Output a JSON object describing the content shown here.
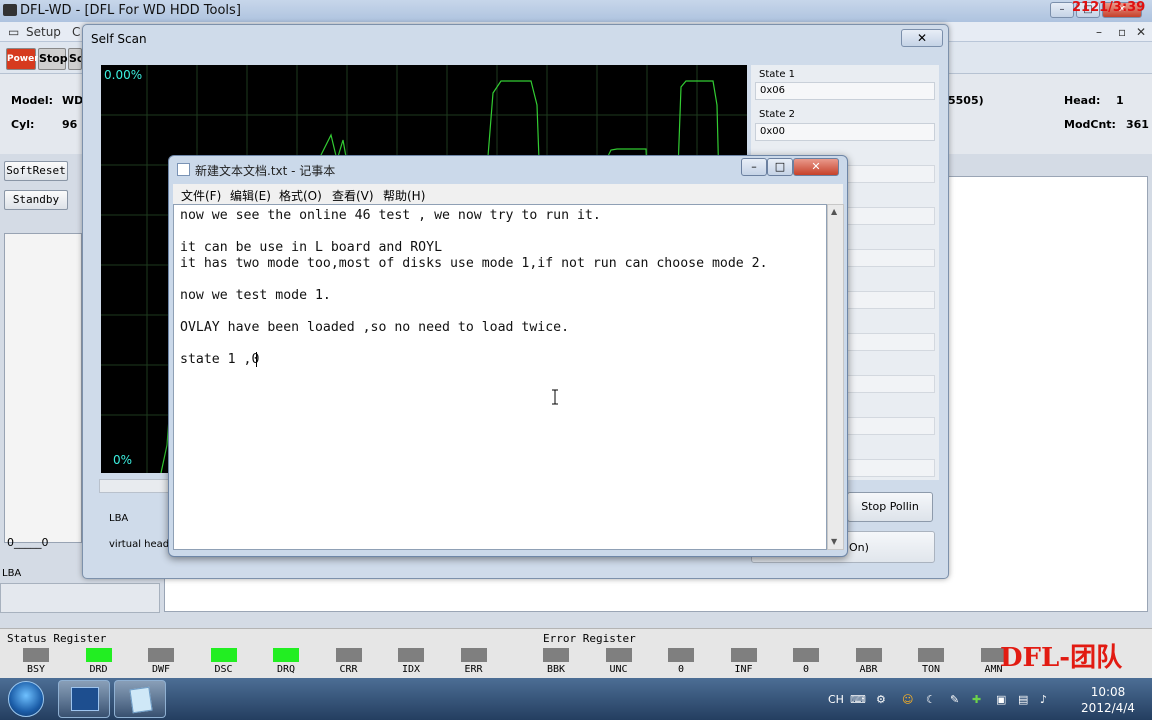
{
  "main": {
    "title": "DFL-WD - [DFL For WD HDD Tools]",
    "overlay_time": "2121/3:39",
    "menu": [
      "Setup",
      "C"
    ],
    "toolbar": {
      "power": "Power",
      "stop": "Stop",
      "third": "Sc"
    },
    "info": {
      "model_label": "Model:",
      "model_value": "WD",
      "cyl_label": "Cyl:",
      "cyl_value": "96",
      "right_fragment": "5505)",
      "head_label": "Head:",
      "head_value": "1",
      "modcnt_label": "ModCnt:",
      "modcnt_value": "361"
    },
    "buttons": {
      "softreset": "SoftReset",
      "standby": "Standby"
    },
    "left_counter": "0_____0",
    "lba_label": "LBA"
  },
  "self_scan": {
    "title": "Self Scan",
    "close": "✕",
    "chart_top_label": "0.00%",
    "chart_bottom_label": "0%",
    "state1_label": "State 1",
    "state1_value": "0x06",
    "state2_label": "State 2",
    "state2_value": "0x00",
    "lba_label": "LBA",
    "virtual_head_label": "virtual head",
    "stop_polling": "Stop Pollin",
    "on_fragment": "On)"
  },
  "notepad": {
    "title": "新建文本文档.txt - 记事本",
    "menu": [
      "文件(F)",
      "编辑(E)",
      "格式(O)",
      "查看(V)",
      "帮助(H)"
    ],
    "lines": [
      "now we see the online 46 test , we now try to run it.",
      "",
      "it can be use in L board and ROYL",
      "it has two mode too,most of disks use mode 1,if not run can choose mode 2.",
      "",
      "now we test mode 1.",
      "",
      "OVLAY have been loaded ,so no need to load twice.",
      "",
      "state 1 ,0"
    ]
  },
  "status_register": {
    "title": "Status Register",
    "items": [
      {
        "label": "BSY",
        "color": "#7f7f7f"
      },
      {
        "label": "DRD",
        "color": "#22ee22"
      },
      {
        "label": "DWF",
        "color": "#7f7f7f"
      },
      {
        "label": "DSC",
        "color": "#22ee22"
      },
      {
        "label": "DRQ",
        "color": "#22ee22"
      },
      {
        "label": "CRR",
        "color": "#7f7f7f"
      },
      {
        "label": "IDX",
        "color": "#7f7f7f"
      },
      {
        "label": "ERR",
        "color": "#7f7f7f"
      }
    ]
  },
  "error_register": {
    "title": "Error Register",
    "items": [
      {
        "label": "BBK",
        "color": "#7f7f7f"
      },
      {
        "label": "UNC",
        "color": "#7f7f7f"
      },
      {
        "label": "0",
        "color": "#7f7f7f"
      },
      {
        "label": "INF",
        "color": "#7f7f7f"
      },
      {
        "label": "0",
        "color": "#7f7f7f"
      },
      {
        "label": "ABR",
        "color": "#7f7f7f"
      },
      {
        "label": "TON",
        "color": "#7f7f7f"
      },
      {
        "label": "AMN",
        "color": "#7f7f7f"
      }
    ]
  },
  "watermark": "DFL-团队",
  "taskbar": {
    "lang": "CH",
    "time": "10:08",
    "date": "2012/4/4"
  }
}
